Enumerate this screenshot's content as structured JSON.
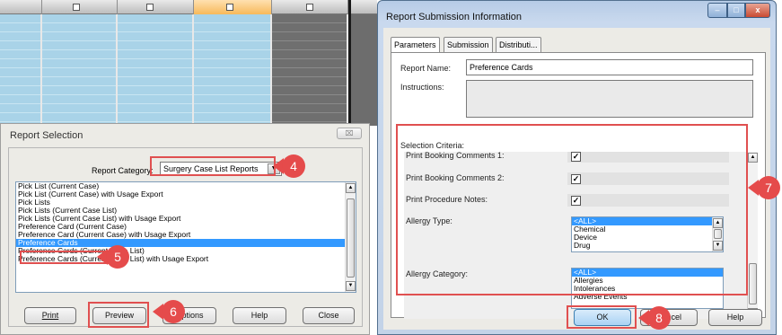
{
  "report_selection": {
    "title": "Report Selection",
    "close_glyph": "⌧",
    "category_label": "Report Category:",
    "category_value": "Surgery Case List Reports",
    "items": [
      {
        "label": "Pick List (Current Case)"
      },
      {
        "label": "Pick List (Current Case) with Usage Export"
      },
      {
        "label": "Pick Lists"
      },
      {
        "label": "Pick Lists (Current Case List)"
      },
      {
        "label": "Pick Lists (Current Case List) with Usage Export"
      },
      {
        "label": "Preference Card (Current Case)"
      },
      {
        "label": "Preference Card (Current Case) with Usage Export"
      },
      {
        "label": "Preference Cards",
        "selected": true
      },
      {
        "label": "Preference Cards (Current Case List)"
      },
      {
        "label": "Preference Cards (Current Case List) with Usage Export"
      }
    ],
    "buttons": {
      "print": "Print",
      "preview": "Preview",
      "options": "Options",
      "help": "Help",
      "close": "Close"
    }
  },
  "report_submission": {
    "title": "Report Submission Information",
    "window_buttons": {
      "min": "–",
      "max": "□",
      "close": "x"
    },
    "tabs": [
      "Parameters",
      "Submission",
      "Distributi..."
    ],
    "report_name_label": "Report Name:",
    "report_name_value": "Preference Cards",
    "instructions_label": "Instructions:",
    "selection_criteria_label": "Selection Criteria:",
    "criteria": {
      "booking_comments_1_label": "Print Booking Comments 1:",
      "booking_comments_1_checked": true,
      "booking_comments_2_label": "Print Booking Comments 2:",
      "booking_comments_2_checked": true,
      "procedure_notes_label": "Print Procedure Notes:",
      "procedure_notes_checked": true,
      "allergy_type_label": "Allergy Type:",
      "allergy_type_options": [
        "<ALL>",
        "Chemical",
        "Device",
        "Drug"
      ],
      "allergy_category_label": "Allergy Category:",
      "allergy_category_options": [
        "<ALL>",
        "Allergies",
        "Intolerances",
        "Adverse Events"
      ]
    },
    "buttons": {
      "ok": "OK",
      "cancel": "Cancel",
      "help": "Help"
    }
  },
  "annotations": {
    "step4": "4",
    "step5": "5",
    "step6": "6",
    "step7": "7",
    "step8": "8",
    "color": "#e54b4b"
  }
}
